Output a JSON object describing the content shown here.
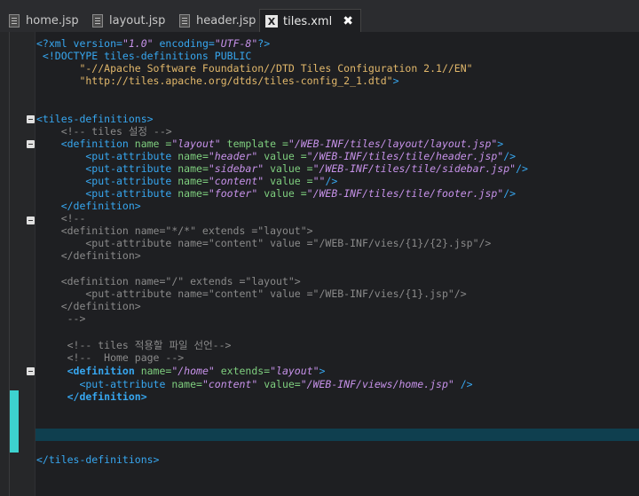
{
  "tabs": [
    {
      "label": "home.jsp",
      "active": false
    },
    {
      "label": "layout.jsp",
      "active": false
    },
    {
      "label": "header.jsp",
      "active": false
    },
    {
      "label": "tiles.xml",
      "active": true
    }
  ],
  "active_tab_icon": "X",
  "close_glyph": "✖",
  "code": {
    "l1_a": "<?xml version=",
    "l1_v1": "\"1.0\"",
    "l1_b": " encoding=",
    "l1_v2": "\"UTF-8\"",
    "l1_c": "?>",
    "l2_a": " <!DOCTYPE tiles-definitions PUBLIC",
    "l3": "       \"-//Apache Software Foundation//DTD Tiles Configuration 2.1//EN\"",
    "l4_a": "       \"http://tiles.apache.org/dtds/tiles-config_2_1.dtd\"",
    "l4_b": ">",
    "l5": "<tiles-definitions>",
    "l6": "    <!-- tiles 설정 -->",
    "l7_a": "    <definition",
    "l7_b": " name =",
    "l7_v1": "\"layout\"",
    "l7_c": " template =",
    "l7_v2": "\"/WEB-INF/tiles/layout/layout.jsp\"",
    "l7_d": ">",
    "pa": [
      {
        "name": "\"header\"",
        "value": "\"/WEB-INF/tiles/tile/header.jsp\""
      },
      {
        "name": "\"sidebar\"",
        "value": "\"/WEB-INF/tiles/tile/sidebar.jsp\""
      },
      {
        "name": "\"content\"",
        "value": "\"\""
      },
      {
        "name": "\"footer\"",
        "value": "\"/WEB-INF/tiles/tile/footer.jsp\""
      }
    ],
    "pa_tag": "        <put-attribute",
    "pa_name": " name=",
    "pa_value": " value =",
    "pa_end": "/>",
    "l12": "    </definition>",
    "c1": "    <!--",
    "c2": "    <definition name=\"*/*\" extends =\"layout\">",
    "c3": "        <put-attribute name=\"content\" value =\"/WEB-INF/vies/{1}/{2}.jsp\"/>",
    "c4": "    </definition>",
    "c5": "    <definition name=\"/\" extends =\"layout\">",
    "c6": "        <put-attribute name=\"content\" value =\"/WEB-INF/vies/{1}.jsp\"/>",
    "c7": "    </definition>",
    "c8": "     -->",
    "c9": "     <!-- tiles 적용할 파일 선언-->",
    "c10": "     <!--  Home page -->",
    "h1_a": "     <definition",
    "h1_b": " name=",
    "h1_v1": "\"/home\"",
    "h1_c": " extends=",
    "h1_v2": "\"layout\"",
    "h1_d": ">",
    "h2_a": "       <put-attribute",
    "h2_b": " name=",
    "h2_v1": "\"content\"",
    "h2_c": " value=",
    "h2_v2": "\"/WEB-INF/views/home.jsp\"",
    "h2_d": " />",
    "h3": "     </definition>",
    "end": "</tiles-definitions>"
  }
}
